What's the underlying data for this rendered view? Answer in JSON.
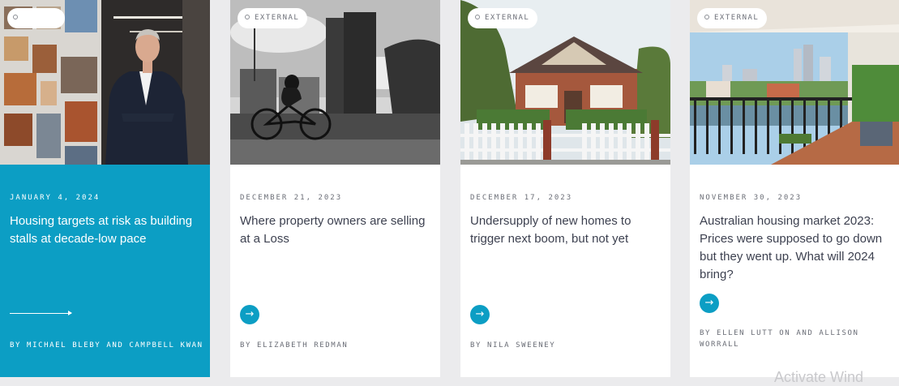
{
  "cards": [
    {
      "tag": "",
      "date": "JANUARY 4, 2024",
      "title": "Housing targets at risk as building stalls at decade-low pace",
      "byline": "BY MICHAEL BLEBY AND CAMPBELL KWAN",
      "image": "man in suit beside wall of building photos"
    },
    {
      "tag": "EXTERNAL",
      "date": "DECEMBER 21, 2023",
      "title": "Where property owners are selling at a Loss",
      "byline": "BY ELIZABETH REDMAN",
      "image": "cyclist in front of high-rise towers and crane"
    },
    {
      "tag": "EXTERNAL",
      "date": "DECEMBER 17, 2023",
      "title": "Undersupply of new homes to trigger next boom, but not yet",
      "byline": "BY NILA SWEENEY",
      "image": "brick house with white picket fence"
    },
    {
      "tag": "EXTERNAL",
      "date": "NOVEMBER 30, 2023",
      "title": "Australian housing market 2023: Prices were supposed to go down but they went up. What will 2024 bring?",
      "byline": "BY ELLEN LUTT ON AND ALLISON WORRALL",
      "image": "balcony overlooking river and city skyline"
    }
  ],
  "icons": {
    "arrow": "→"
  },
  "colors": {
    "accent": "#0c9ec4",
    "text": "#3d4150",
    "muted": "#6a6d76"
  },
  "watermark": "Activate Wind"
}
